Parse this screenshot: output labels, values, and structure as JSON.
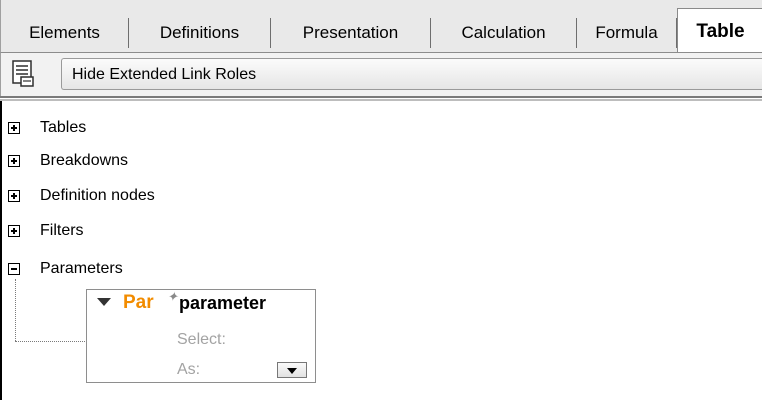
{
  "tabs": [
    {
      "label": "Elements"
    },
    {
      "label": "Definitions"
    },
    {
      "label": "Presentation"
    },
    {
      "label": "Calculation"
    },
    {
      "label": "Formula"
    },
    {
      "label": "Table",
      "active": true
    }
  ],
  "toolbar": {
    "toggle_icon": "document-list-icon",
    "button_label": "Hide Extended Link Roles"
  },
  "tree": {
    "nodes": [
      {
        "label": "Tables",
        "state": "collapsed"
      },
      {
        "label": "Breakdowns",
        "state": "collapsed"
      },
      {
        "label": "Definition nodes",
        "state": "collapsed"
      },
      {
        "label": "Filters",
        "state": "collapsed"
      },
      {
        "label": "Parameters",
        "state": "expanded"
      }
    ]
  },
  "parameter_box": {
    "prefix": "Par",
    "name": "parameter",
    "select_label": "Select:",
    "as_label": "As:",
    "accent_color": "#f28c00"
  }
}
